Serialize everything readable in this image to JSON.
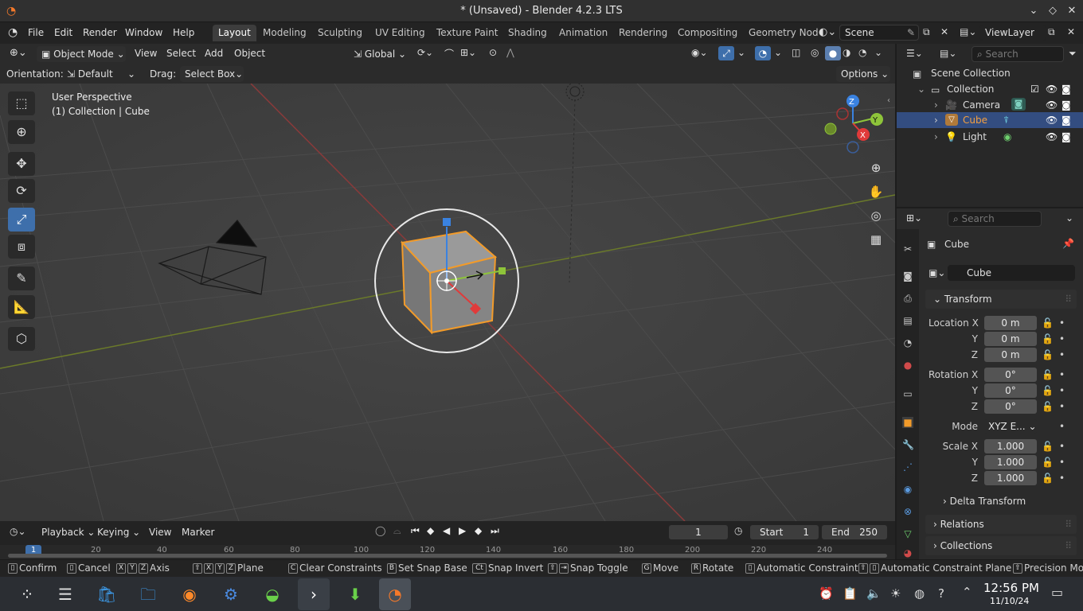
{
  "window": {
    "title": "* (Unsaved) - Blender 4.2.3 LTS"
  },
  "menu": [
    "File",
    "Edit",
    "Render",
    "Window",
    "Help"
  ],
  "workspaces": [
    "Layout",
    "Modeling",
    "Sculpting",
    "UV Editing",
    "Texture Paint",
    "Shading",
    "Animation",
    "Rendering",
    "Compositing",
    "Geometry Nod"
  ],
  "scene": {
    "name": "Scene",
    "view_layer": "ViewLayer"
  },
  "header": {
    "mode": "Object Mode",
    "view": "View",
    "select": "Select",
    "add": "Add",
    "object": "Object",
    "transform_orientation": "Global",
    "orientation_label": "Orientation:",
    "orientation_value": "Default",
    "drag_label": "Drag:",
    "drag_value": "Select Box",
    "options": "Options"
  },
  "viewport": {
    "perspective": "User Perspective",
    "collection_info": "(1) Collection | Cube"
  },
  "gizmo": {
    "x": "X",
    "y": "Y",
    "z": "Z"
  },
  "outliner": {
    "search_placeholder": "Search",
    "root": "Scene Collection",
    "collection": "Collection",
    "items": [
      "Camera",
      "Cube",
      "Light"
    ]
  },
  "properties": {
    "search_placeholder": "Search",
    "object_name": "Cube",
    "data_name": "Cube",
    "transform": "Transform",
    "location_label": "Location X",
    "rotation_label": "Rotation X",
    "scale_label": "Scale X",
    "y_label": "Y",
    "z_label": "Z",
    "location": [
      "0 m",
      "0 m",
      "0 m"
    ],
    "rotation": [
      "0°",
      "0°",
      "0°"
    ],
    "mode_label": "Mode",
    "mode_value": "XYZ E...",
    "scale": [
      "1.000",
      "1.000",
      "1.000"
    ],
    "delta_transform": "Delta Transform",
    "relations": "Relations",
    "collections": "Collections"
  },
  "timeline": {
    "playback": "Playback",
    "keying": "Keying",
    "view": "View",
    "marker": "Marker",
    "current_frame": "1",
    "start_label": "Start",
    "start": "1",
    "end_label": "End",
    "end": "250",
    "ruler": [
      "1",
      "20",
      "40",
      "60",
      "80",
      "100",
      "120",
      "140",
      "160",
      "180",
      "200",
      "220",
      "240"
    ]
  },
  "status": {
    "confirm": "Confirm",
    "cancel": "Cancel",
    "axis": "Axis",
    "plane": "Plane",
    "clear_constraints": "Clear Constraints",
    "set_snap_base": "Set Snap Base",
    "snap_invert": "Snap Invert",
    "snap_toggle": "Snap Toggle",
    "move": "Move",
    "rotate": "Rotate",
    "automatic_constraint": "Automatic Constraint",
    "automatic_constraint_plane": "Automatic Constraint Plane",
    "precision_mode": "Precision Mo"
  },
  "clock": {
    "time": "12:56 PM",
    "date": "11/10/24"
  }
}
